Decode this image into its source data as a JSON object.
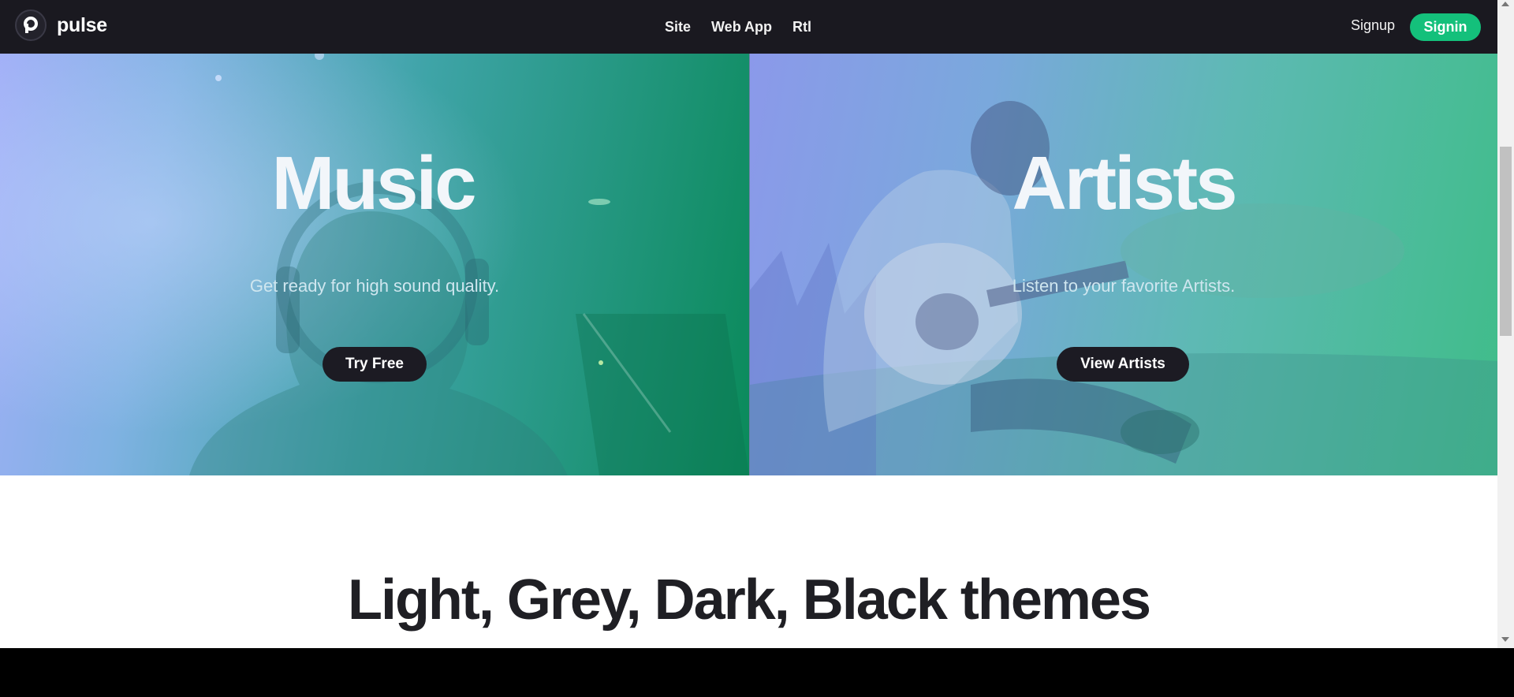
{
  "header": {
    "logo_text": "pulse",
    "logo_letter": "p",
    "nav": [
      "Site",
      "Web App",
      "Rtl"
    ],
    "signup_label": "Signup",
    "signin_label": "Signin",
    "accent_color": "#14c07b"
  },
  "hero": {
    "music": {
      "title": "Music",
      "subtitle": "Get ready for high sound quality.",
      "button": "Try Free"
    },
    "artists": {
      "title": "Artists",
      "subtitle": "Listen to your favorite Artists.",
      "button": "View Artists"
    }
  },
  "section": {
    "title": "Light, Grey, Dark, Black themes"
  },
  "icons": [
    "pulse-logo-icon",
    "scroll-up-arrow-icon",
    "scroll-down-arrow-icon"
  ]
}
